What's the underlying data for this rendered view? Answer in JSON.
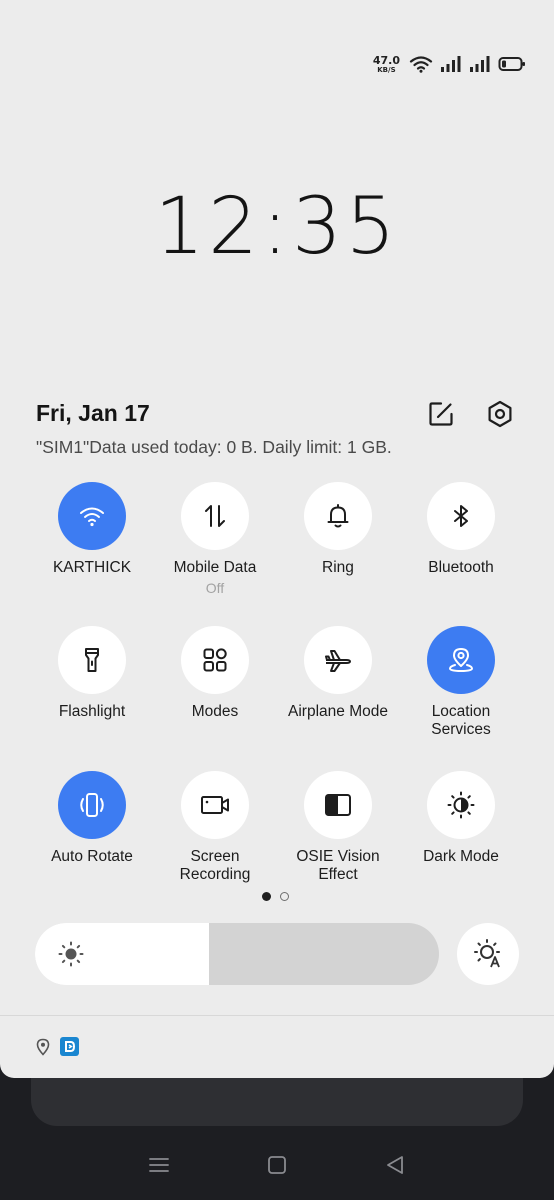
{
  "status_bar": {
    "speed_value": "47.0",
    "speed_unit": "KB/S",
    "icons": [
      "wifi-icon",
      "signal-sim1-icon",
      "signal-sim2-icon",
      "battery-icon"
    ]
  },
  "clock": "12:35",
  "header": {
    "date": "Fri, Jan 17",
    "data_usage": "\"SIM1\"Data used today: 0 B. Daily limit: 1 GB.",
    "icons": [
      "edit-icon",
      "settings-icon"
    ]
  },
  "tiles": [
    {
      "label": "KARTHICK",
      "icon": "wifi-icon",
      "on": true
    },
    {
      "label": "Mobile Data",
      "sublabel": "Off",
      "icon": "mobile-data-icon",
      "on": false
    },
    {
      "label": "Ring",
      "icon": "bell-icon",
      "on": false
    },
    {
      "label": "Bluetooth",
      "icon": "bluetooth-icon",
      "on": false
    },
    {
      "label": "Flashlight",
      "icon": "flashlight-icon",
      "on": false
    },
    {
      "label": "Modes",
      "icon": "grid-icon",
      "on": false
    },
    {
      "label": "Airplane Mode",
      "icon": "airplane-icon",
      "on": false
    },
    {
      "label": "Location\nServices",
      "icon": "location-icon",
      "on": true
    },
    {
      "label": "Auto Rotate",
      "icon": "rotate-icon",
      "on": true
    },
    {
      "label": "Screen\nRecording",
      "icon": "screen-recording-icon",
      "on": false
    },
    {
      "label": "OSIE Vision\nEffect",
      "icon": "vision-effect-icon",
      "on": false
    },
    {
      "label": "Dark Mode",
      "icon": "dark-mode-icon",
      "on": false
    }
  ],
  "pager": {
    "pages": 2,
    "current": 1
  },
  "brightness": {
    "level": 0.43,
    "icons": [
      "brightness-icon",
      "auto-brightness-icon"
    ]
  },
  "colors": {
    "accent": "#3d7cf2",
    "panel": "#ececec",
    "tile": "#ffffff"
  },
  "notifications": {
    "icons": [
      "location-pin-icon",
      "app-badge-icon"
    ]
  },
  "nav_bar": {
    "icons": [
      "menu-icon",
      "home-icon",
      "back-icon"
    ]
  }
}
